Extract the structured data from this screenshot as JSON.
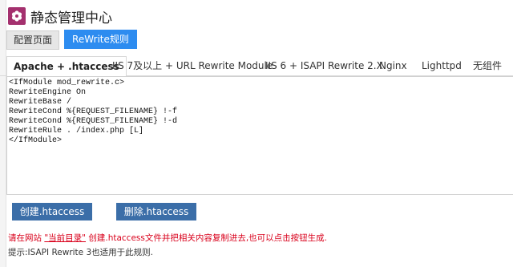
{
  "header": {
    "title": "静态管理中心",
    "logo_icon": "flower-icon",
    "logo_color": "#a4306e"
  },
  "top_buttons": {
    "config": "配置页面",
    "rewrite": "ReWrite规则",
    "active_color": "#2d8cf0"
  },
  "tabs": [
    {
      "label": "Apache + .htaccess",
      "active": true
    },
    {
      "label": "IIS 7及以上 + URL Rewrite Module"
    },
    {
      "label": "IIS 6 + ISAPI Rewrite 2.X"
    },
    {
      "label": "Nginx"
    },
    {
      "label": "Lighttpd"
    },
    {
      "label": "无组件"
    }
  ],
  "editor": {
    "content": "<IfModule mod_rewrite.c>\nRewriteEngine On\nRewriteBase /\nRewriteCond %{REQUEST_FILENAME} !-f\nRewriteCond %{REQUEST_FILENAME} !-d\nRewriteRule . /index.php [L]\n</IfModule>"
  },
  "actions": {
    "create": "创建.htaccess",
    "delete": "删除.htaccess",
    "color": "#3b6ea8"
  },
  "notice": {
    "prefix": "请在网站",
    "link": "\"当前目录\"",
    "suffix": "创建.htaccess文件并把相关内容复制进去,也可以点击按钮生成.",
    "color": "#d9001b"
  },
  "hint": "提示:ISAPI Rewrite 3也适用于此规则."
}
